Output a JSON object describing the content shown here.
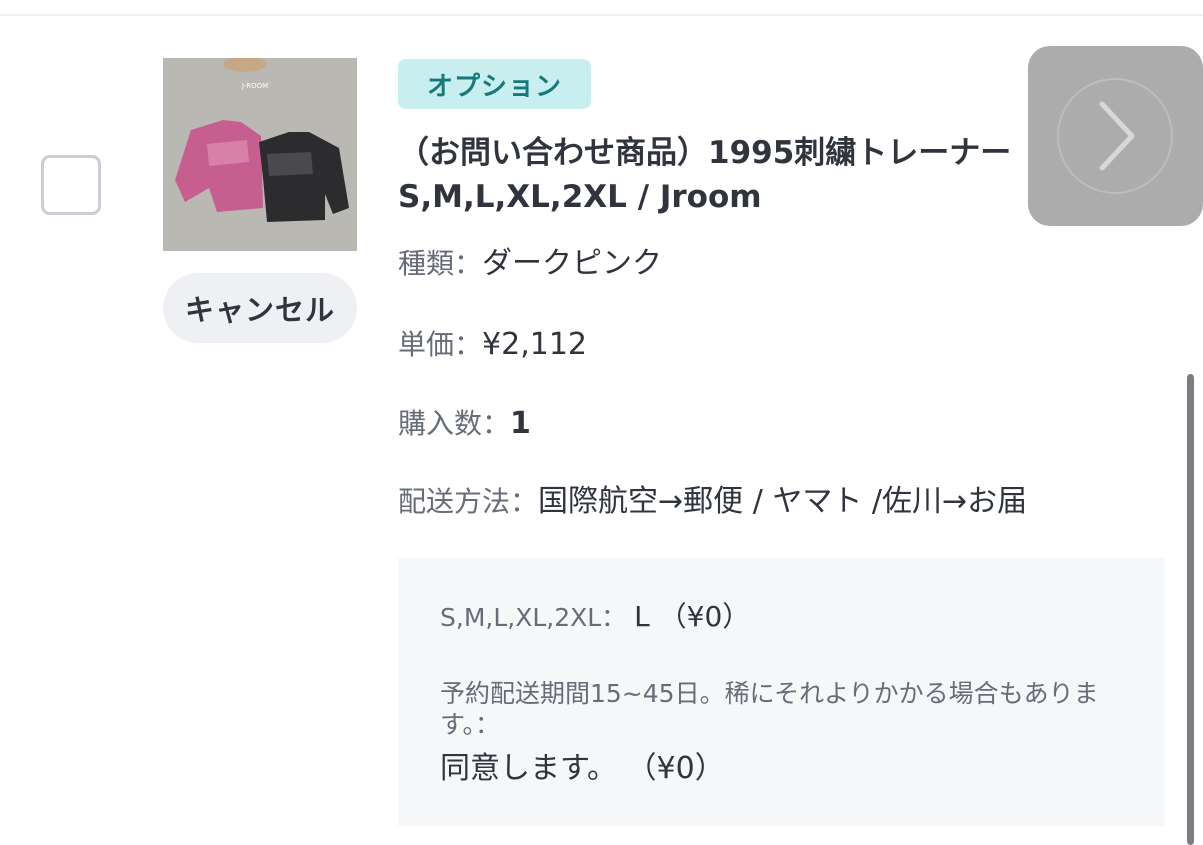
{
  "item": {
    "thumbnail_icon": "product-photo-sweatshirts",
    "cancel_label": "キャンセル",
    "badge_label": "オプション",
    "title": "（お問い合わせ商品）1995刺繍トレーナー S,M,L,XL,2XL / Jroom",
    "attributes": [
      {
        "label": "種類：",
        "value": "ダークピンク"
      },
      {
        "label": "単価：",
        "value": "¥2,112"
      },
      {
        "label": "購入数：",
        "value": "1"
      },
      {
        "label": "配送方法：",
        "value": "国際航空→郵便 / ヤマト /佐川→お届"
      }
    ]
  },
  "options": {
    "size_label": "S,M,L,XL,2XL：",
    "size_value": "L （¥0）",
    "note": "予約配送期間15~45日。稀にそれよりかかる場合もあります。：",
    "agree": "同意します。 （¥0）"
  },
  "next_icon": "chevron-right-icon",
  "colors": {
    "badge_bg": "#c8eef0",
    "badge_text": "#18797b",
    "text_primary": "#2f343d",
    "text_secondary": "#676d77",
    "box_bg": "#f6f7f9"
  }
}
